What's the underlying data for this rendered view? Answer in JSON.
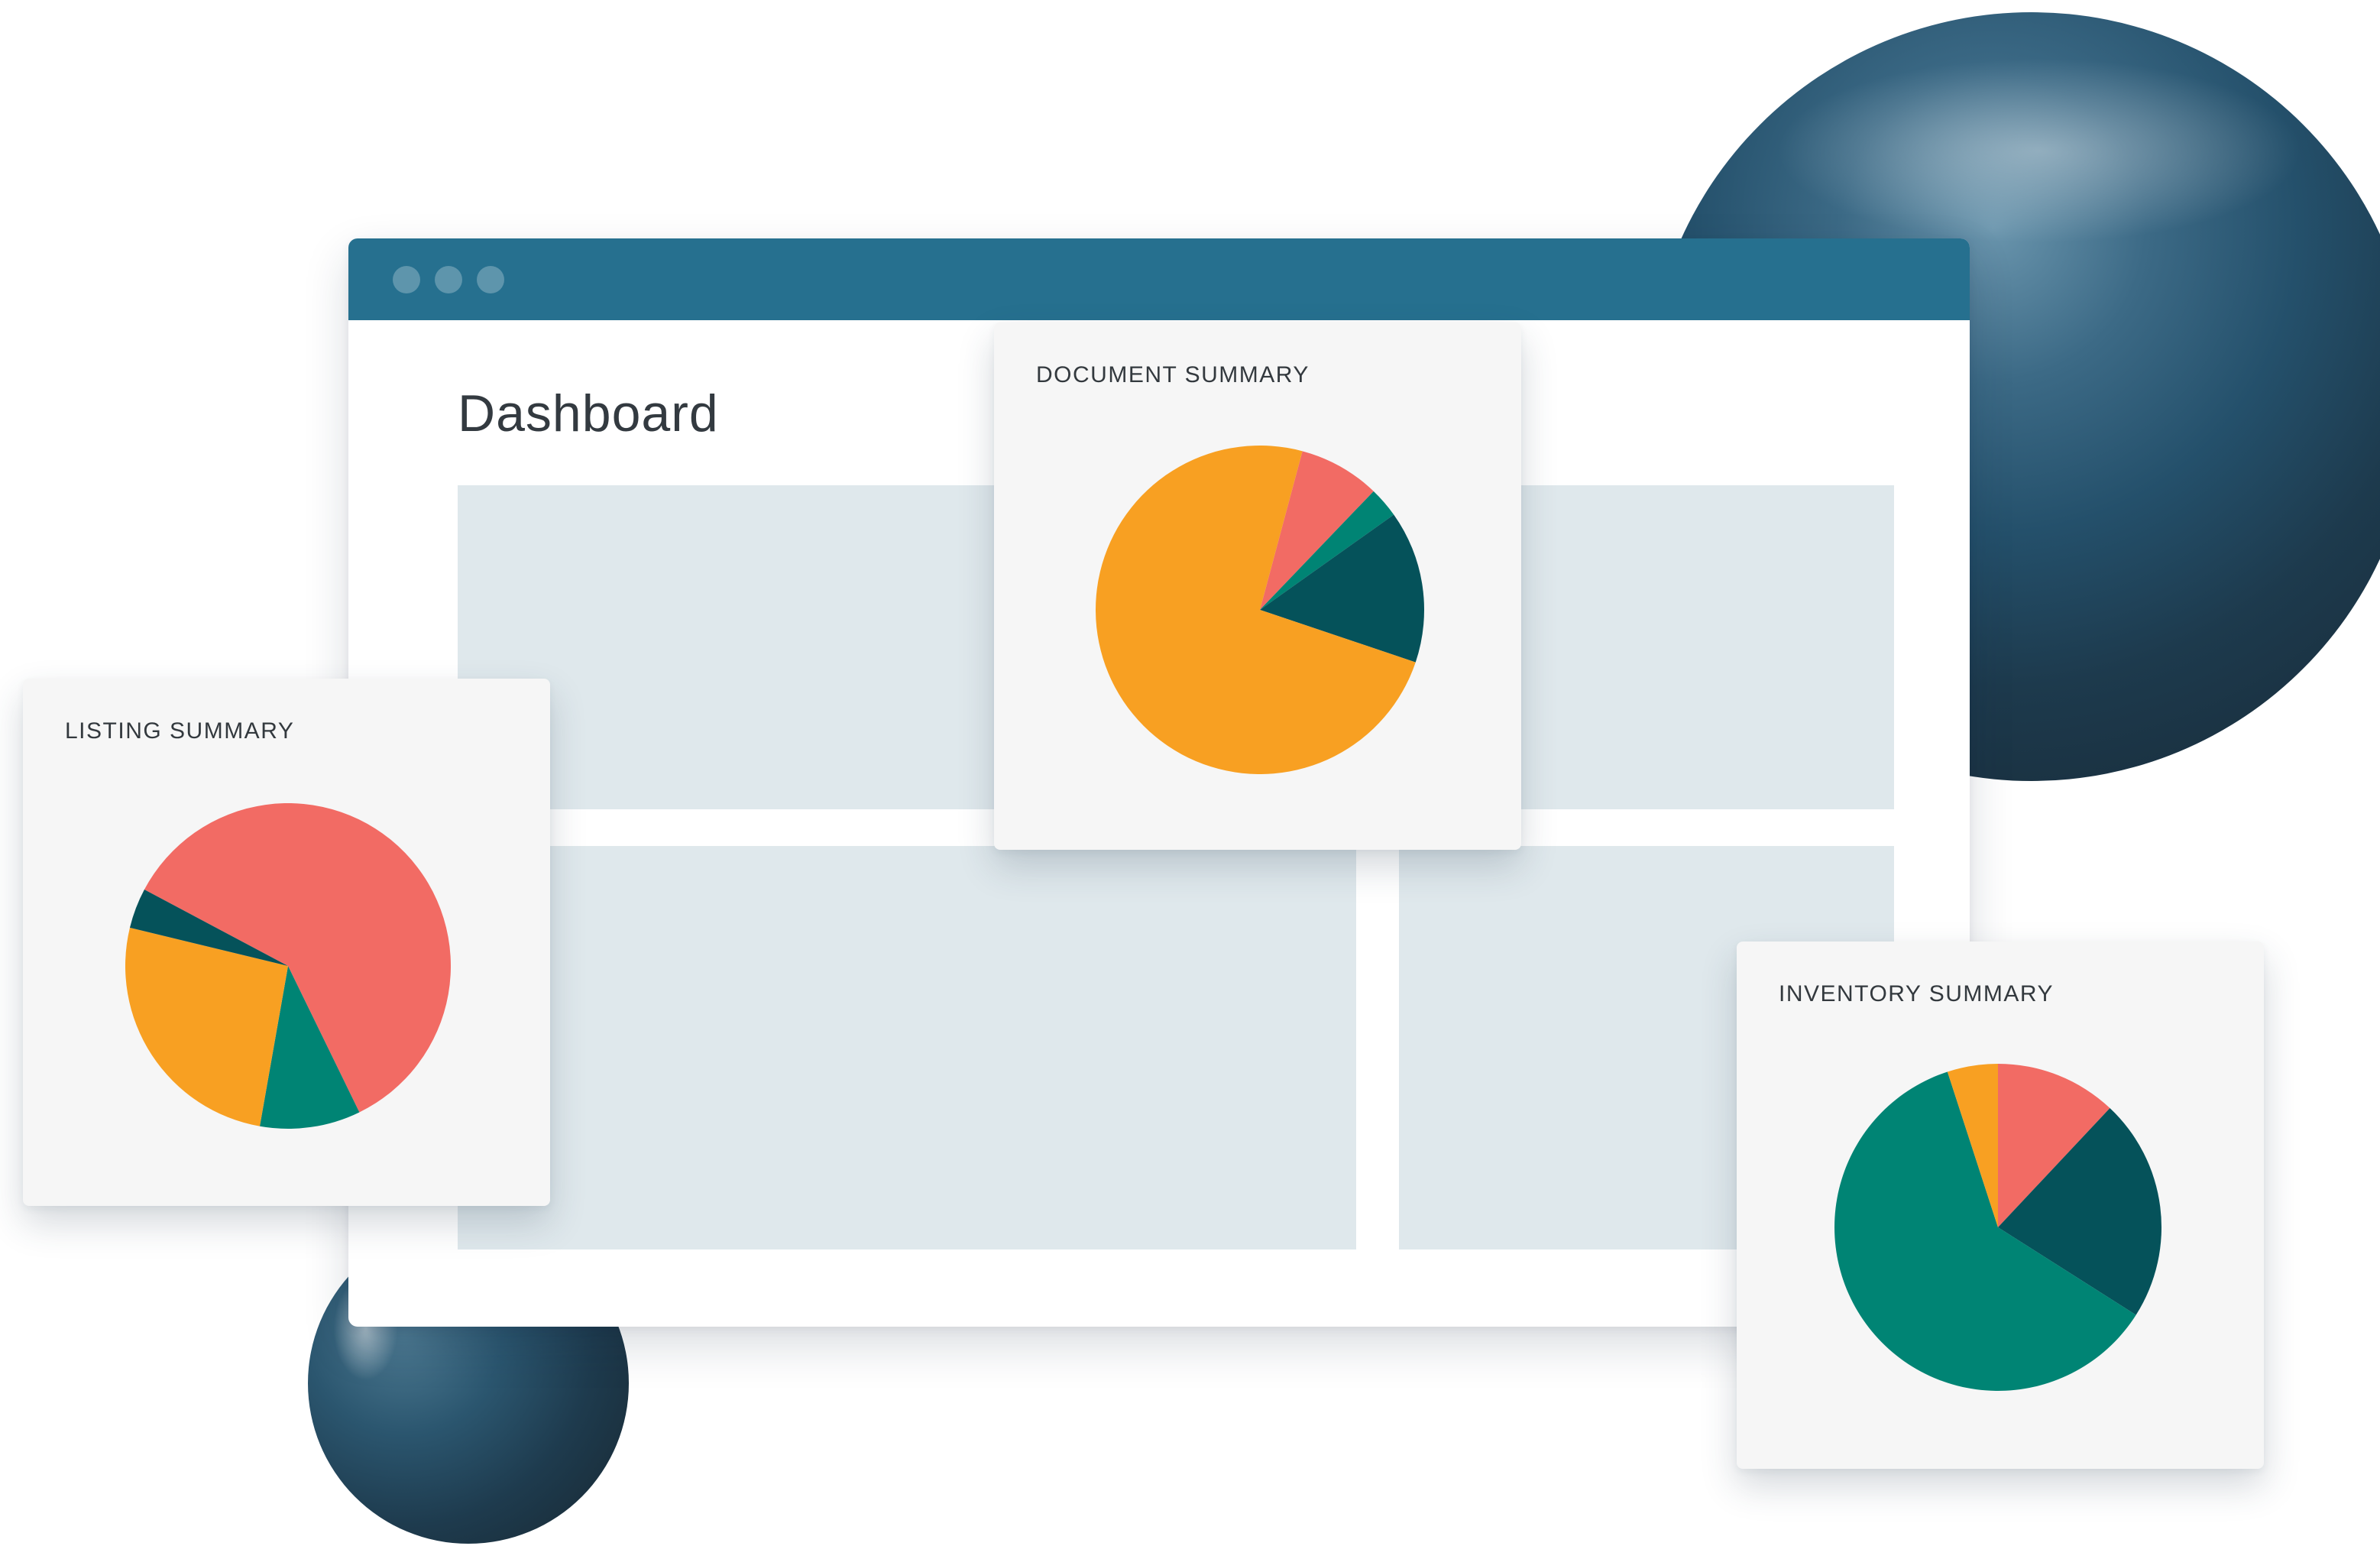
{
  "window": {
    "title": "Dashboard"
  },
  "colors": {
    "coral": "#f26b64",
    "orange": "#f8a022",
    "teal": "#008474",
    "dark_teal": "#05525a",
    "titlebar": "#26708f"
  },
  "chart_data": [
    {
      "type": "pie",
      "title": "LISTING SUMMARY",
      "slices": [
        {
          "value": 60,
          "color": "#f26b64"
        },
        {
          "value": 10,
          "color": "#008474"
        },
        {
          "value": 26,
          "color": "#f8a022"
        },
        {
          "value": 4,
          "color": "#05525a"
        }
      ]
    },
    {
      "type": "pie",
      "title": "DOCUMENT SUMMARY",
      "slices": [
        {
          "value": 8,
          "color": "#f26b64"
        },
        {
          "value": 3,
          "color": "#008474"
        },
        {
          "value": 15,
          "color": "#05525a"
        },
        {
          "value": 74,
          "color": "#f8a022"
        }
      ]
    },
    {
      "type": "pie",
      "title": "INVENTORY SUMMARY",
      "slices": [
        {
          "value": 12,
          "color": "#f26b64"
        },
        {
          "value": 22,
          "color": "#05525a"
        },
        {
          "value": 61,
          "color": "#008474"
        },
        {
          "value": 5,
          "color": "#f8a022"
        }
      ]
    }
  ]
}
